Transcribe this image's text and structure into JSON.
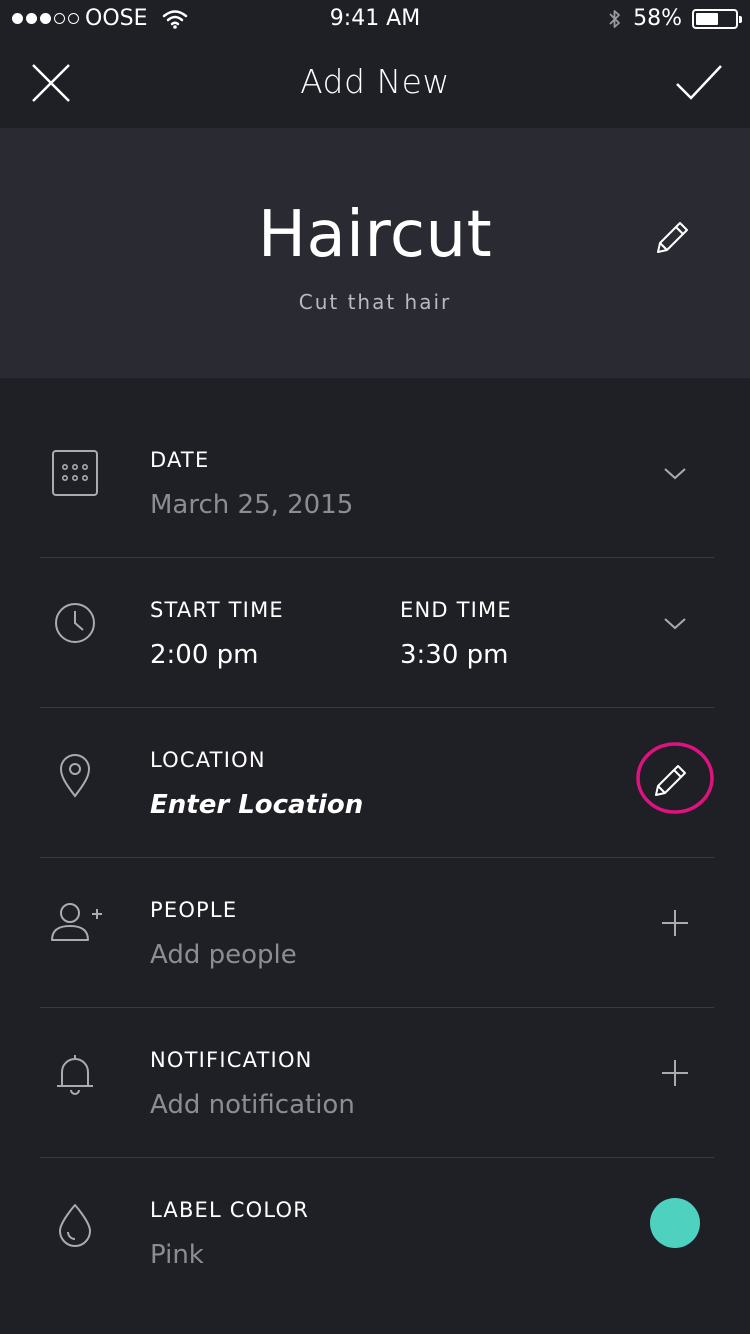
{
  "status_bar": {
    "carrier": "OOSE",
    "time": "9:41 AM",
    "battery": "58%",
    "battery_level": 0.58
  },
  "nav": {
    "title": "Add New",
    "close_icon": "close-icon",
    "confirm_icon": "checkmark-icon"
  },
  "header": {
    "title": "Haircut",
    "subtitle": "Cut that hair",
    "edit_icon": "pencil-icon"
  },
  "fields": {
    "date": {
      "label": "DATE",
      "value": "March 25, 2015",
      "icon": "calendar-icon"
    },
    "time": {
      "start_label": "START TIME",
      "start_value": "2:00 pm",
      "end_label": "END TIME",
      "end_value": "3:30 pm",
      "icon": "clock-icon"
    },
    "location": {
      "label": "LOCATION",
      "value": "Enter Location",
      "icon": "location-pin-icon"
    },
    "people": {
      "label": "PEOPLE",
      "value": "Add people",
      "icon": "add-person-icon"
    },
    "notification": {
      "label": "NOTIFICATION",
      "value": "Add notification",
      "icon": "bell-icon"
    },
    "label_color": {
      "label": "LABEL COLOR",
      "value": "Pink",
      "icon": "drop-icon",
      "swatch_color": "#4fd1c0"
    }
  },
  "colors": {
    "background": "#1f1f26",
    "header_background": "#2a2a32",
    "highlight_ring": "#e0127f",
    "muted_text": "#8c8c94"
  }
}
